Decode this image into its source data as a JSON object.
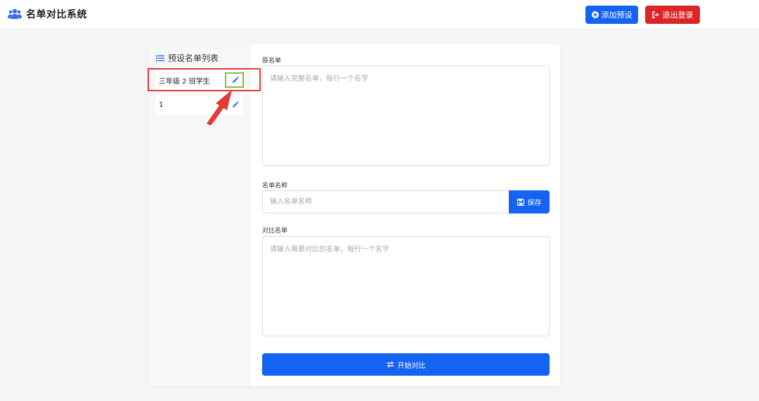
{
  "header": {
    "title": "名单对比系统",
    "brand_icon": "users-icon",
    "add_button_label": "添加预设",
    "logout_button_label": "退出登录"
  },
  "sidebar": {
    "title": "预设名单列表",
    "items": [
      {
        "label": "三年级 2 班学生",
        "icon": "pencil-icon"
      },
      {
        "label": "1",
        "icon": "pencil-icon"
      }
    ]
  },
  "form": {
    "original_label": "原名单",
    "original_placeholder": "请输入完整名单，每行一个名字",
    "name_label": "名单名称",
    "name_placeholder": "输入名单名称",
    "save_label": "保存",
    "compare_list_label": "对比名单",
    "compare_placeholder": "请输入需要对比的名单，每行一个名字",
    "start_label": "开始对比"
  },
  "colors": {
    "primary": "#1463f3",
    "danger": "#dc2626",
    "highlight_red": "#e53935",
    "highlight_green": "#7cc142"
  }
}
